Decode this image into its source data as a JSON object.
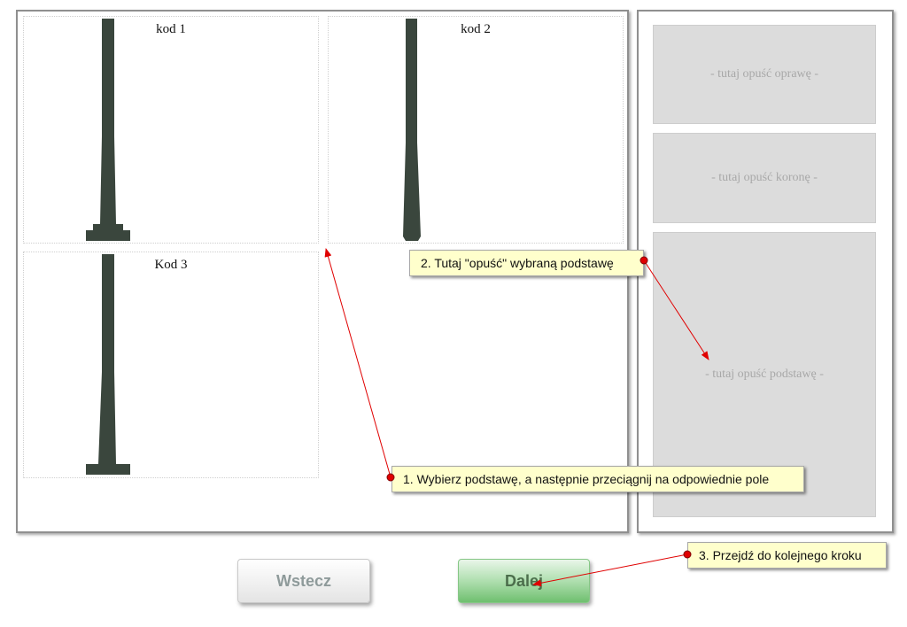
{
  "colors": {
    "pole": "#3a463d",
    "arrow": "#e00000",
    "tooltip_bg": "#ffffcc",
    "drop_zone_bg": "#dcdcdc",
    "next_button": "#8fd08f"
  },
  "bases": [
    {
      "label": "kod 1",
      "shape": "pole-with-stepped-base"
    },
    {
      "label": "kod 2",
      "shape": "pole-tapered-no-plinth"
    },
    {
      "label": "Kod 3",
      "shape": "pole-with-flat-base"
    }
  ],
  "drop_zones": {
    "fixture": "- tutaj opuść oprawę -",
    "crown": "- tutaj opuść koronę -",
    "base": "- tutaj opuść podstawę -"
  },
  "buttons": {
    "back": "Wstecz",
    "next": "Dalej"
  },
  "tooltips": {
    "step1": "1. Wybierz podstawę, a następnie przeciągnij na odpowiednie pole",
    "step2": "2. Tutaj \"opuść\" wybraną podstawę",
    "step3": "3. Przejdź do kolejnego kroku"
  }
}
